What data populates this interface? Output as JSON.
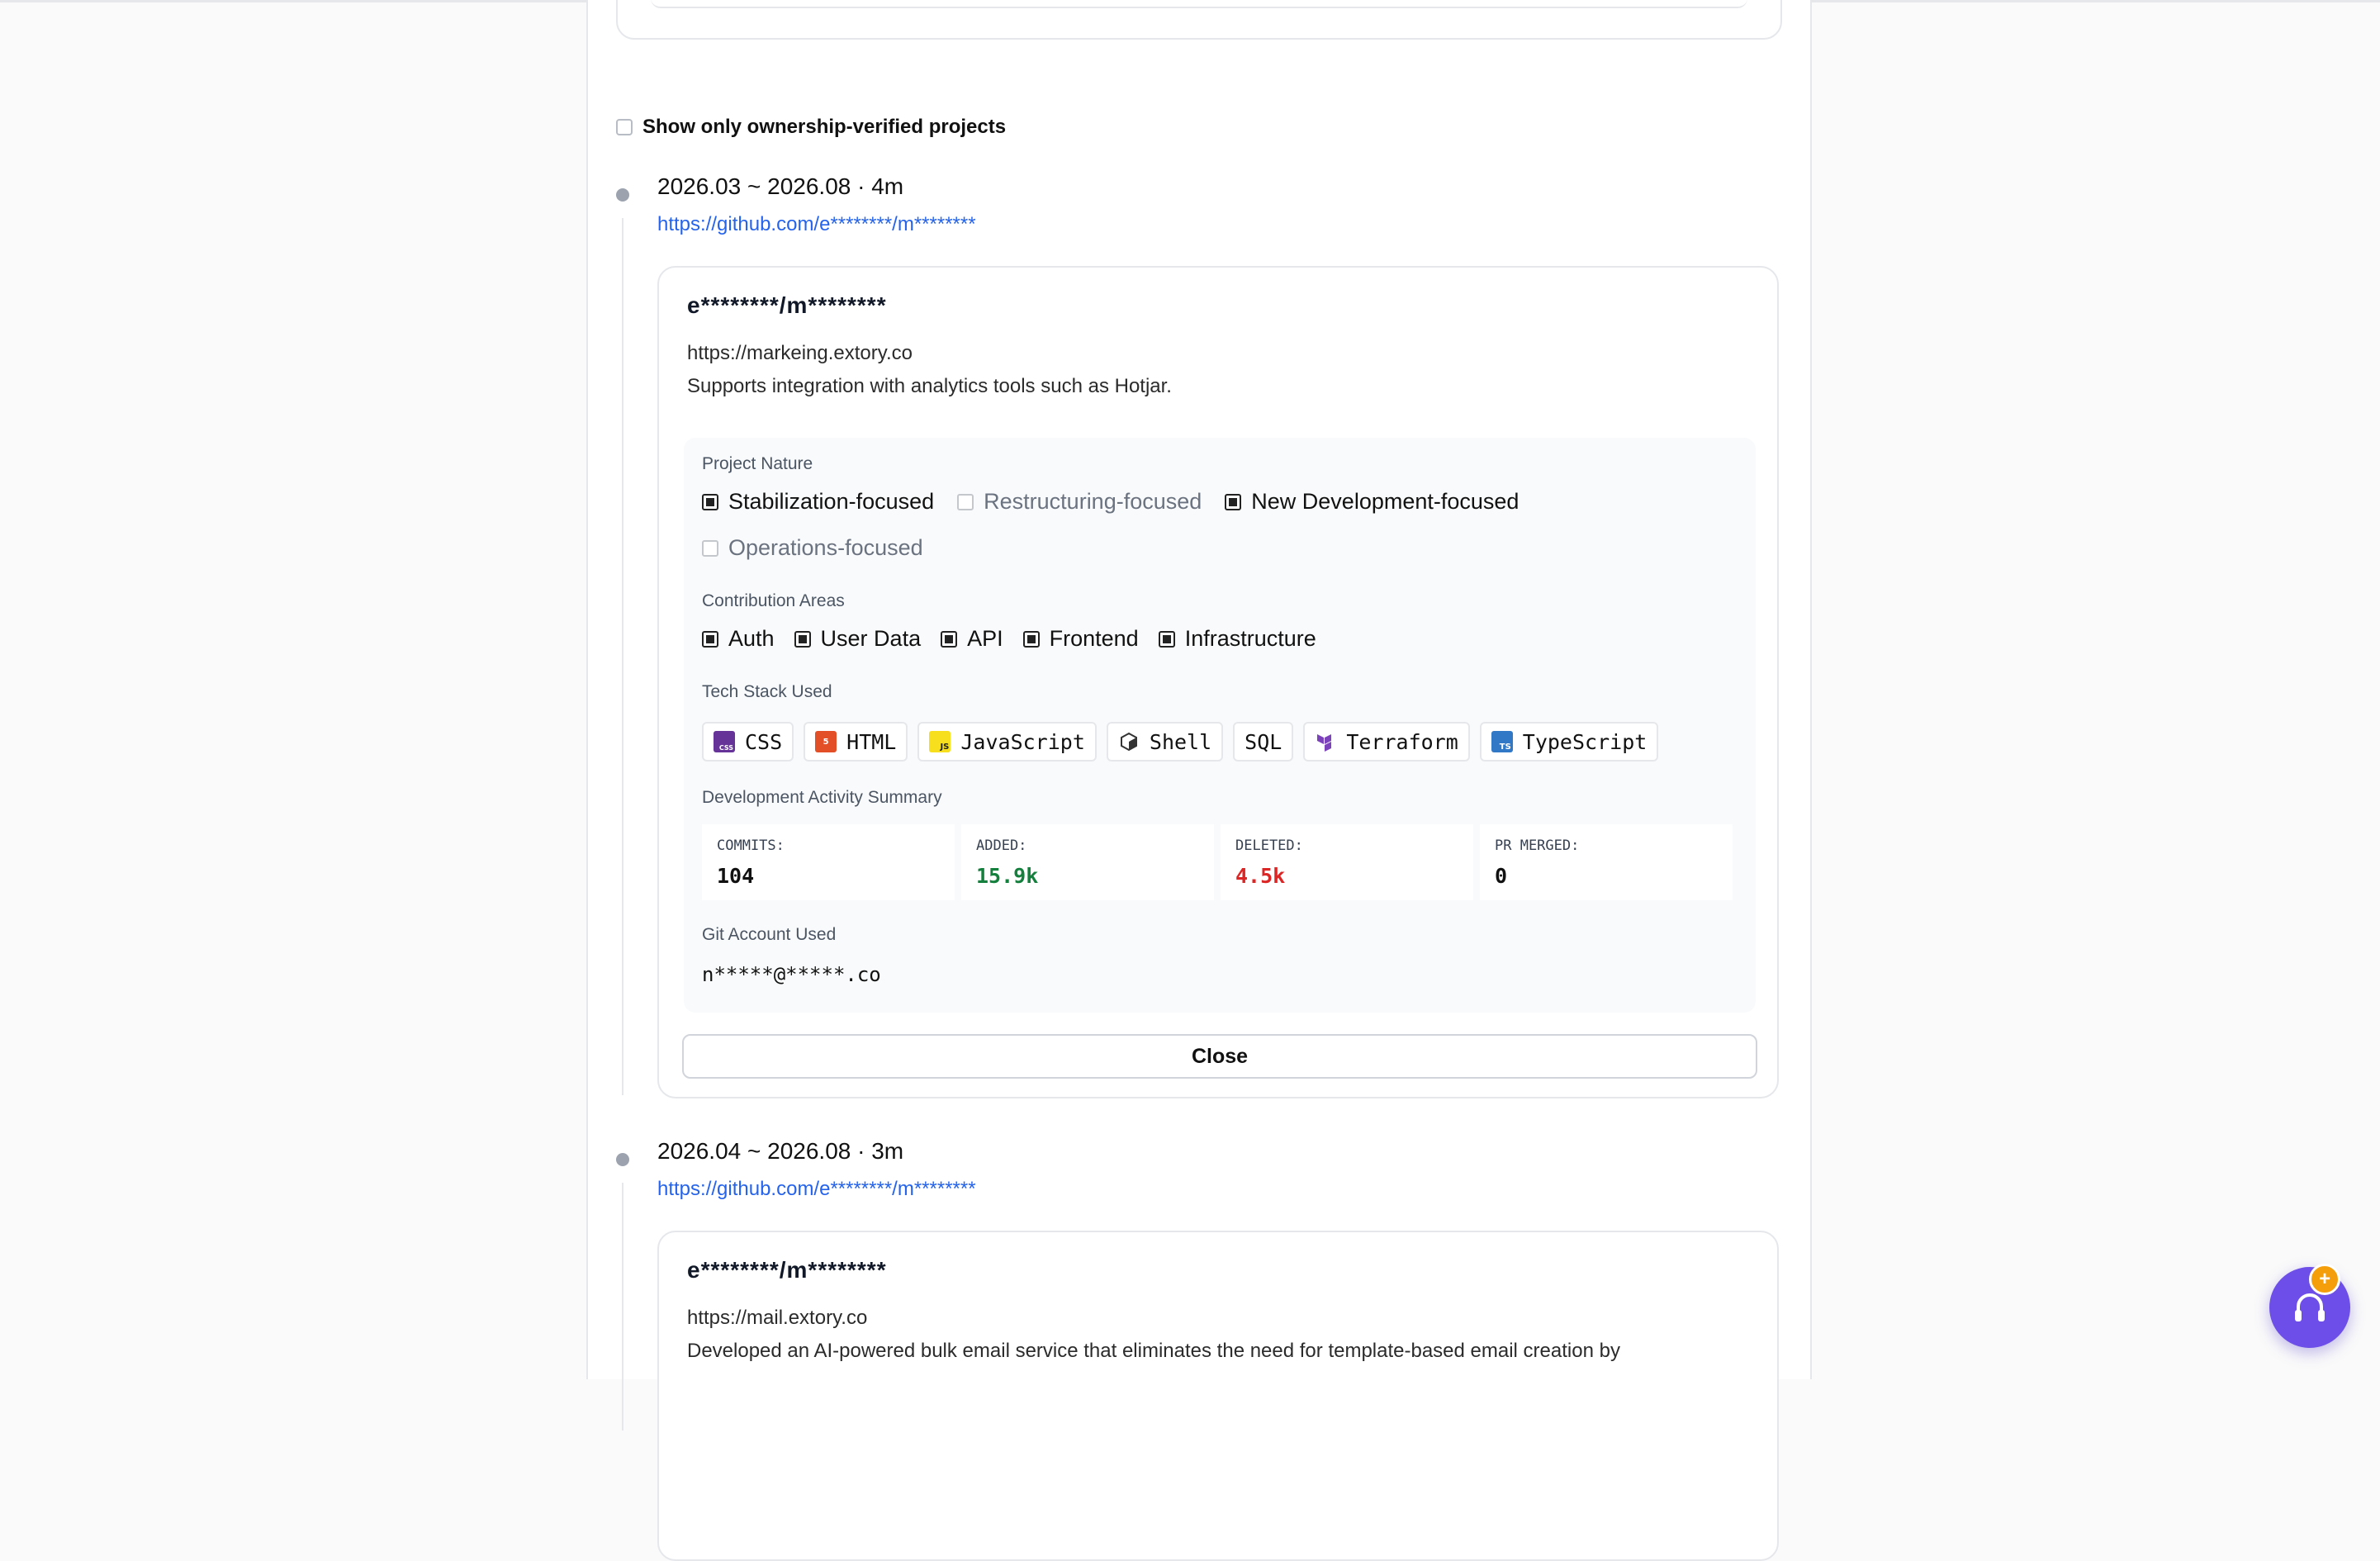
{
  "filter": {
    "label": "Show only ownership-verified projects",
    "checked": false
  },
  "entries": [
    {
      "period": "2026.03 ~ 2026.08 · 4m",
      "repo_url": "https://github.com/e********/m********",
      "card": {
        "title": "e********/m********",
        "url": "https://markeing.extory.co",
        "description": "Supports integration with analytics tools such as Hotjar.",
        "project_nature_label": "Project Nature",
        "project_nature": [
          {
            "label": "Stabilization-focused",
            "checked": true
          },
          {
            "label": "Restructuring-focused",
            "checked": false
          },
          {
            "label": "New Development-focused",
            "checked": true
          },
          {
            "label": "Operations-focused",
            "checked": false
          }
        ],
        "contribution_label": "Contribution Areas",
        "contribution_areas": [
          {
            "label": "Auth",
            "checked": true
          },
          {
            "label": "User Data",
            "checked": true
          },
          {
            "label": "API",
            "checked": true
          },
          {
            "label": "Frontend",
            "checked": true
          },
          {
            "label": "Infrastructure",
            "checked": true
          }
        ],
        "tech_label": "Tech Stack Used",
        "tech_stack": [
          {
            "name": "CSS",
            "icon": "css-icon",
            "color": "#663399",
            "mark": "CSS"
          },
          {
            "name": "HTML",
            "icon": "html-icon",
            "color": "#e34f26",
            "mark": "5"
          },
          {
            "name": "JavaScript",
            "icon": "javascript-icon",
            "color": "#f7df1e",
            "mark": "JS"
          },
          {
            "name": "Shell",
            "icon": "shell-icon",
            "color": "#ffffff",
            "mark": ""
          },
          {
            "name": "SQL",
            "icon": "",
            "color": "",
            "mark": ""
          },
          {
            "name": "Terraform",
            "icon": "terraform-icon",
            "color": "#7b42bc",
            "mark": ""
          },
          {
            "name": "TypeScript",
            "icon": "typescript-icon",
            "color": "#3178c6",
            "mark": "TS"
          }
        ],
        "activity_label": "Development Activity Summary",
        "stats": [
          {
            "label": "COMMITS:",
            "value": "104",
            "color": "#111111"
          },
          {
            "label": "ADDED:",
            "value": "15.9k",
            "color": "#15803d"
          },
          {
            "label": "DELETED:",
            "value": "4.5k",
            "color": "#dc2626"
          },
          {
            "label": "PR MERGED:",
            "value": "0",
            "color": "#111111"
          }
        ],
        "git_label": "Git Account Used",
        "git_account": "n*****@*****.co",
        "close_label": "Close"
      }
    },
    {
      "period": "2026.04 ~ 2026.08 · 3m",
      "repo_url": "https://github.com/e********/m********",
      "card": {
        "title": "e********/m********",
        "url": "https://mail.extory.co",
        "description": "Developed an AI-powered bulk email service that eliminates the need for template-based email creation by"
      }
    }
  ],
  "support_button": {
    "icon": "headset-icon",
    "badge": "+",
    "color": "#6d4ee8",
    "badge_color": "#f59e0b"
  }
}
